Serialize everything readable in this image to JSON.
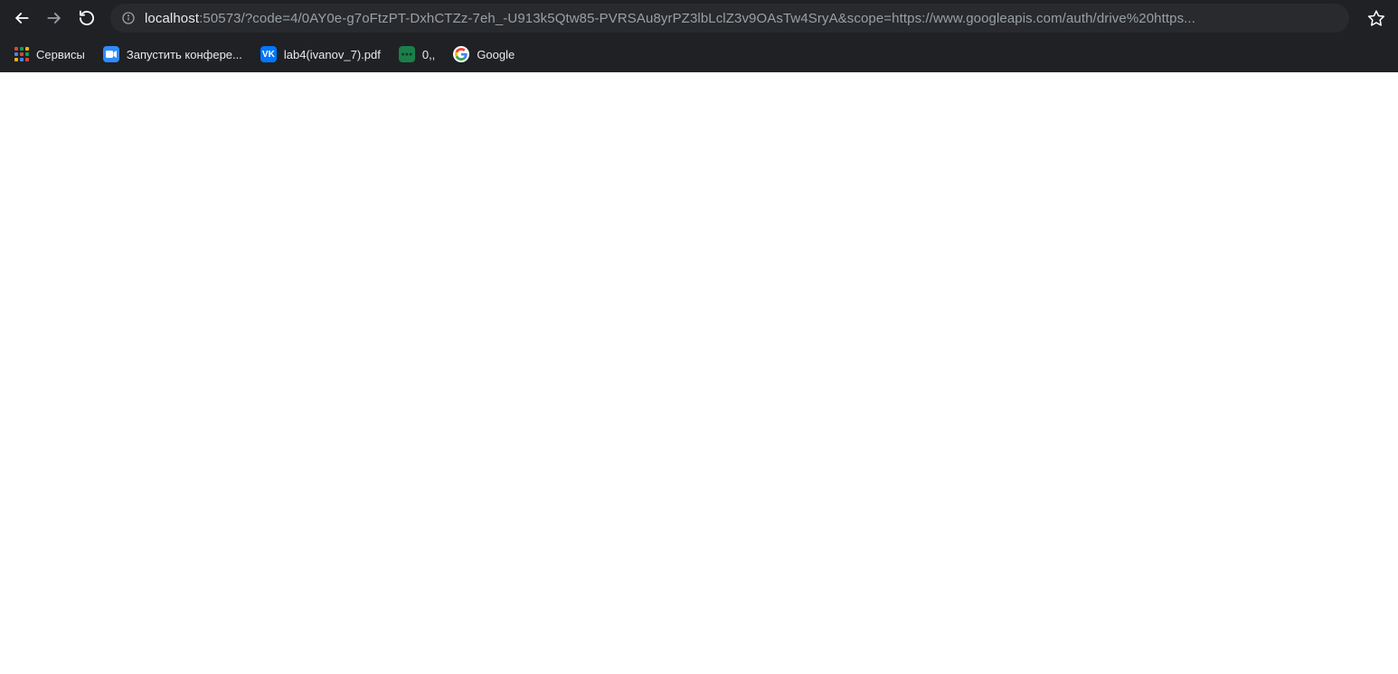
{
  "toolbar": {
    "url_host": "localhost",
    "url_rest": ":50573/?code=4/0AY0e-g7oFtzPT-DxhCTZz-7eh_-U913k5Qtw85-PVRSAu8yrPZ3lbLclZ3v9OAsTw4SryA&scope=https://www.googleapis.com/auth/drive%20https..."
  },
  "bookmarks": {
    "apps_label": "Сервисы",
    "items": [
      {
        "label": "Запустить конфере...",
        "icon": "zoom"
      },
      {
        "label": "lab4(ivanov_7).pdf",
        "icon": "vk"
      },
      {
        "label": "0,,",
        "icon": "green"
      },
      {
        "label": "Google",
        "icon": "google"
      }
    ]
  }
}
